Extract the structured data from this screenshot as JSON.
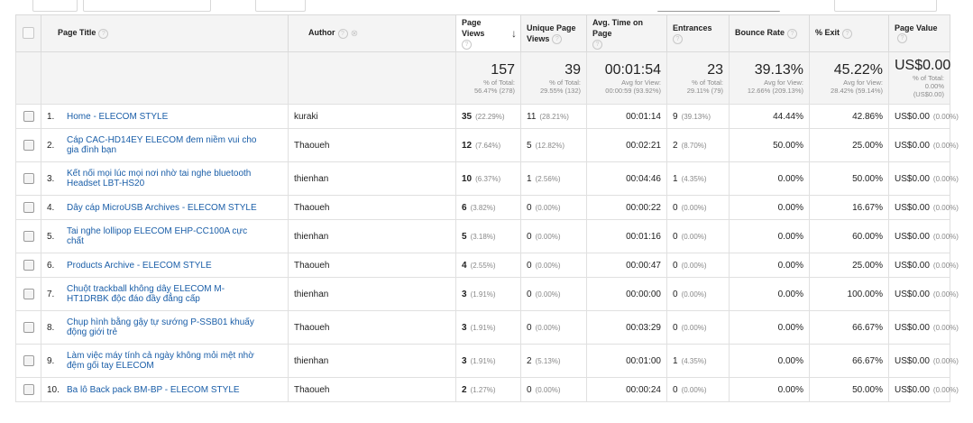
{
  "columns": {
    "page_title": "Page Title",
    "author": "Author",
    "page_views": "Page Views",
    "unique_page_views": "Unique Page Views",
    "avg_time": "Avg. Time on Page",
    "entrances": "Entrances",
    "bounce_rate": "Bounce Rate",
    "exit": "% Exit",
    "page_value": "Page Value"
  },
  "icons": {
    "help": "?",
    "sort_desc": "↓"
  },
  "totals": {
    "page_views": {
      "value": "157",
      "sub1": "% of Total:",
      "sub2": "56.47% (278)"
    },
    "unique_page_views": {
      "value": "39",
      "sub1": "% of Total:",
      "sub2": "29.55% (132)"
    },
    "avg_time": {
      "value": "00:01:54",
      "sub1": "Avg for View:",
      "sub2": "00:00:59 (93.92%)"
    },
    "entrances": {
      "value": "23",
      "sub1": "% of Total:",
      "sub2": "29.11% (79)"
    },
    "bounce_rate": {
      "value": "39.13%",
      "sub1": "Avg for View:",
      "sub2": "12.66% (209.13%)"
    },
    "exit": {
      "value": "45.22%",
      "sub1": "Avg for View:",
      "sub2": "28.42% (59.14%)"
    },
    "page_value": {
      "value": "US$0.00",
      "sub1": "% of Total: 0.00%",
      "sub2": "(US$0.00)"
    }
  },
  "rows": [
    {
      "idx": "1.",
      "title": "Home - ELECOM STYLE",
      "author": "kuraki",
      "pv": "35",
      "pv_pct": "(22.29%)",
      "upv": "11",
      "upv_pct": "(28.21%)",
      "time": "00:01:14",
      "ent": "9",
      "ent_pct": "(39.13%)",
      "bounce": "44.44%",
      "exit": "42.86%",
      "value": "US$0.00",
      "value_pct": "(0.00%)"
    },
    {
      "idx": "2.",
      "title": "Cáp CAC-HD14EY ELECOM đem niềm vui cho gia đình bạn",
      "author": "Thaoueh",
      "pv": "12",
      "pv_pct": "(7.64%)",
      "upv": "5",
      "upv_pct": "(12.82%)",
      "time": "00:02:21",
      "ent": "2",
      "ent_pct": "(8.70%)",
      "bounce": "50.00%",
      "exit": "25.00%",
      "value": "US$0.00",
      "value_pct": "(0.00%)"
    },
    {
      "idx": "3.",
      "title": "Kết nối mọi lúc mọi nơi nhờ tai nghe bluetooth Headset LBT-HS20",
      "author": "thienhan",
      "pv": "10",
      "pv_pct": "(6.37%)",
      "upv": "1",
      "upv_pct": "(2.56%)",
      "time": "00:04:46",
      "ent": "1",
      "ent_pct": "(4.35%)",
      "bounce": "0.00%",
      "exit": "50.00%",
      "value": "US$0.00",
      "value_pct": "(0.00%)"
    },
    {
      "idx": "4.",
      "title": "Dây cáp MicroUSB Archives - ELECOM STYLE",
      "author": "Thaoueh",
      "pv": "6",
      "pv_pct": "(3.82%)",
      "upv": "0",
      "upv_pct": "(0.00%)",
      "time": "00:00:22",
      "ent": "0",
      "ent_pct": "(0.00%)",
      "bounce": "0.00%",
      "exit": "16.67%",
      "value": "US$0.00",
      "value_pct": "(0.00%)"
    },
    {
      "idx": "5.",
      "title": "Tai nghe lollipop ELECOM EHP-CC100A cực chất",
      "author": "thienhan",
      "pv": "5",
      "pv_pct": "(3.18%)",
      "upv": "0",
      "upv_pct": "(0.00%)",
      "time": "00:01:16",
      "ent": "0",
      "ent_pct": "(0.00%)",
      "bounce": "0.00%",
      "exit": "60.00%",
      "value": "US$0.00",
      "value_pct": "(0.00%)"
    },
    {
      "idx": "6.",
      "title": "Products Archive - ELECOM STYLE",
      "author": "Thaoueh",
      "pv": "4",
      "pv_pct": "(2.55%)",
      "upv": "0",
      "upv_pct": "(0.00%)",
      "time": "00:00:47",
      "ent": "0",
      "ent_pct": "(0.00%)",
      "bounce": "0.00%",
      "exit": "25.00%",
      "value": "US$0.00",
      "value_pct": "(0.00%)"
    },
    {
      "idx": "7.",
      "title": "Chuột trackball không dây ELECOM M-HT1DRBK độc đáo đầy đẳng cấp",
      "author": "thienhan",
      "pv": "3",
      "pv_pct": "(1.91%)",
      "upv": "0",
      "upv_pct": "(0.00%)",
      "time": "00:00:00",
      "ent": "0",
      "ent_pct": "(0.00%)",
      "bounce": "0.00%",
      "exit": "100.00%",
      "value": "US$0.00",
      "value_pct": "(0.00%)"
    },
    {
      "idx": "8.",
      "title": "Chụp hình bằng gậy tự sướng P-SSB01 khuấy động giới trẻ",
      "author": "Thaoueh",
      "pv": "3",
      "pv_pct": "(1.91%)",
      "upv": "0",
      "upv_pct": "(0.00%)",
      "time": "00:03:29",
      "ent": "0",
      "ent_pct": "(0.00%)",
      "bounce": "0.00%",
      "exit": "66.67%",
      "value": "US$0.00",
      "value_pct": "(0.00%)"
    },
    {
      "idx": "9.",
      "title": "Làm việc máy tính cả ngày không mỏi mệt nhờ đệm gối tay ELECOM",
      "author": "thienhan",
      "pv": "3",
      "pv_pct": "(1.91%)",
      "upv": "2",
      "upv_pct": "(5.13%)",
      "time": "00:01:00",
      "ent": "1",
      "ent_pct": "(4.35%)",
      "bounce": "0.00%",
      "exit": "66.67%",
      "value": "US$0.00",
      "value_pct": "(0.00%)"
    },
    {
      "idx": "10.",
      "title": "Ba lô Back pack BM-BP - ELECOM STYLE",
      "author": "Thaoueh",
      "pv": "2",
      "pv_pct": "(1.27%)",
      "upv": "0",
      "upv_pct": "(0.00%)",
      "time": "00:00:24",
      "ent": "0",
      "ent_pct": "(0.00%)",
      "bounce": "0.00%",
      "exit": "50.00%",
      "value": "US$0.00",
      "value_pct": "(0.00%)"
    }
  ]
}
